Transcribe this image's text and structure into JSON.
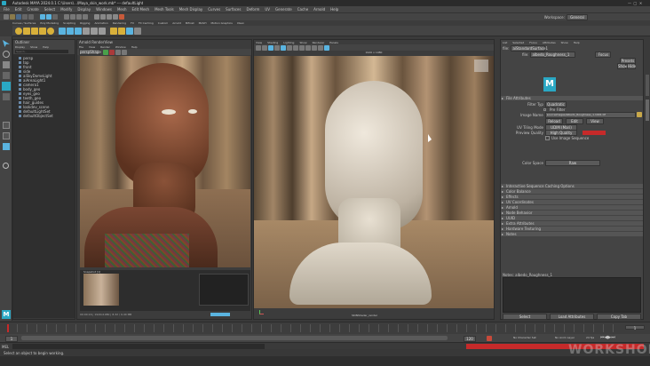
{
  "window": {
    "title": "Autodesk MAYA 2024.0.1 C:\\Users\\...\\Maya_skin_work.mb*  ---  defaultLight"
  },
  "menubar": {
    "items": [
      "File",
      "Edit",
      "Create",
      "Select",
      "Modify",
      "Display",
      "Windows",
      "Mesh",
      "Edit Mesh",
      "Mesh Tools",
      "Mesh Display",
      "Curves",
      "Surfaces",
      "Deform",
      "UV",
      "Generate",
      "Cache",
      "Arnold",
      "Help"
    ],
    "workspace_label": "Workspace:",
    "workspace_value": "General"
  },
  "shelf": {
    "tabs": [
      "Curves / Surfaces",
      "Poly Modeling",
      "Sculpting",
      "Rigging",
      "Animation",
      "Rendering",
      "FX",
      "FX Caching",
      "Custom",
      "Arnold",
      "Bifrost",
      "MASH",
      "Motion Graphics",
      "XGen"
    ]
  },
  "outliner": {
    "title": "Outliner",
    "menu": [
      "Display",
      "Show",
      "Help"
    ],
    "search_placeholder": "Search...",
    "items": [
      "persp",
      "top",
      "front",
      "side",
      "aiSkyDomeLight",
      "aiAreaLight1",
      "camera1",
      "body_geo",
      "eyes_geo",
      "teeth_geo",
      "hair_guides",
      "lookdev_scene",
      "defaultLightSet",
      "defaultObjectSet"
    ]
  },
  "render_view": {
    "title": "Arnold RenderView",
    "menu": [
      "File",
      "View",
      "Render",
      "Window",
      "Help"
    ],
    "camera": "perspShape",
    "snapshot_label": "Snapshot [1]",
    "status": "00:00:16 | 1920x1080 | 8.32 / 9.40 MB"
  },
  "viewport": {
    "menu": [
      "View",
      "Shading",
      "Lighting",
      "Show",
      "Renderer",
      "Panels"
    ],
    "camera_label": "persp",
    "frame_label": "1920 x 1080",
    "footer_label": "SKINShader_render"
  },
  "attribute_editor": {
    "tabs": [
      "List",
      "Selected",
      "Focus",
      "Attributes",
      "Show",
      "Help"
    ],
    "node_field": "aiStandardSurface1",
    "focus_btn": "Focus",
    "presets_btn": "Presets",
    "show_btn": "Show",
    "hide_btn": "Hide",
    "node_type": "file:",
    "node_name": "albedo_Roughness_1",
    "section_file": "File Attributes",
    "filter_type_label": "Filter Type",
    "filter_type_value": "Quadratic",
    "prefilter_label": "Pre Filter",
    "image_name_label": "Image Name",
    "image_name_value": "sourceimages/albedo_Roughness_1.1001.tif",
    "reload_btn": "Reload",
    "edit_btn": "Edit",
    "view_btn": "View",
    "uv_tiling_label": "UV Tiling Mode",
    "uv_tiling_value": "UDIM (Mari)",
    "preview_label": "Preview Quality",
    "preview_value": "High Quality",
    "use_image_seq": "Use Image Sequence",
    "color_space_label": "Color Space",
    "color_space_value": "Raw",
    "sections": [
      "Interactive Sequence Caching Options",
      "Color Balance",
      "Effects",
      "UV Coordinates",
      "Arnold",
      "Node Behavior",
      "UUID",
      "Extra Attributes",
      "Hardware Texturing",
      "Notes"
    ],
    "notes_label": "Notes: albedo_Roughness_1",
    "select_btn": "Select",
    "load_btn": "Load Attributes",
    "copy_btn": "Copy Tab"
  },
  "timeline": {
    "start": "1",
    "end": "120",
    "current": "1",
    "fps": "24 fps",
    "no_char": "No Character Set",
    "no_anim": "No Anim Layer"
  },
  "status_bar": {
    "mel_label": "MEL",
    "message": "Select an object to begin working.",
    "watermark": "WORKSHOP"
  },
  "colors": {
    "accent": "#5ab4e0",
    "red_bar": "#c62a2a",
    "maya_blue": "#2aa8c4"
  }
}
